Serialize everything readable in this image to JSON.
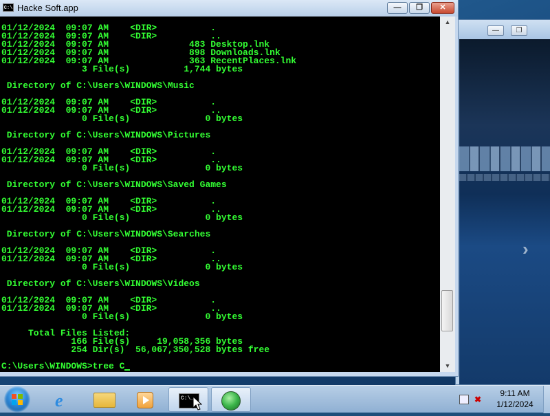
{
  "window": {
    "title": "Hacke Soft.app",
    "icon_label": "C:\\",
    "minimize_label": "—",
    "maximize_label": "❐",
    "close_label": "✕"
  },
  "terminal": {
    "lines": [
      "01/12/2024  09:07 AM    <DIR>          .",
      "01/12/2024  09:07 AM    <DIR>          ..",
      "01/12/2024  09:07 AM               483 Desktop.lnk",
      "01/12/2024  09:07 AM               898 Downloads.lnk",
      "01/12/2024  09:07 AM               363 RecentPlaces.lnk",
      "               3 File(s)          1,744 bytes",
      "",
      " Directory of C:\\Users\\WINDOWS\\Music",
      "",
      "01/12/2024  09:07 AM    <DIR>          .",
      "01/12/2024  09:07 AM    <DIR>          ..",
      "               0 File(s)              0 bytes",
      "",
      " Directory of C:\\Users\\WINDOWS\\Pictures",
      "",
      "01/12/2024  09:07 AM    <DIR>          .",
      "01/12/2024  09:07 AM    <DIR>          ..",
      "               0 File(s)              0 bytes",
      "",
      " Directory of C:\\Users\\WINDOWS\\Saved Games",
      "",
      "01/12/2024  09:07 AM    <DIR>          .",
      "01/12/2024  09:07 AM    <DIR>          ..",
      "               0 File(s)              0 bytes",
      "",
      " Directory of C:\\Users\\WINDOWS\\Searches",
      "",
      "01/12/2024  09:07 AM    <DIR>          .",
      "01/12/2024  09:07 AM    <DIR>          ..",
      "               0 File(s)              0 bytes",
      "",
      " Directory of C:\\Users\\WINDOWS\\Videos",
      "",
      "01/12/2024  09:07 AM    <DIR>          .",
      "01/12/2024  09:07 AM    <DIR>          ..",
      "               0 File(s)              0 bytes",
      "",
      "     Total Files Listed:",
      "             166 File(s)     19,058,356 bytes",
      "             254 Dir(s)  56,067,350,528 bytes free",
      ""
    ],
    "prompt": "C:\\Users\\WINDOWS>",
    "input": "tree C"
  },
  "scrollbar": {
    "up_arrow": "▲",
    "down_arrow": "▼",
    "position": 0.9
  },
  "background_window": {
    "minimize_label": "—",
    "maximize_label": "❐",
    "nav_arrow": "›"
  },
  "taskbar": {
    "items": [
      {
        "name": "internet-explorer",
        "icon": "ie-icon",
        "label": "e"
      },
      {
        "name": "windows-explorer",
        "icon": "folder-icon"
      },
      {
        "name": "media-player",
        "icon": "media-player-icon"
      },
      {
        "name": "command-prompt",
        "icon": "cmd-icon",
        "label": "C:\\_",
        "active": true
      },
      {
        "name": "windows-media-center",
        "icon": "media-center-icon"
      }
    ],
    "volume_glyph": "✖",
    "clock_time": "9:11 AM",
    "clock_date": "1/12/2024"
  },
  "colors": {
    "console_text": "#33ff33",
    "console_bg": "#000000"
  }
}
